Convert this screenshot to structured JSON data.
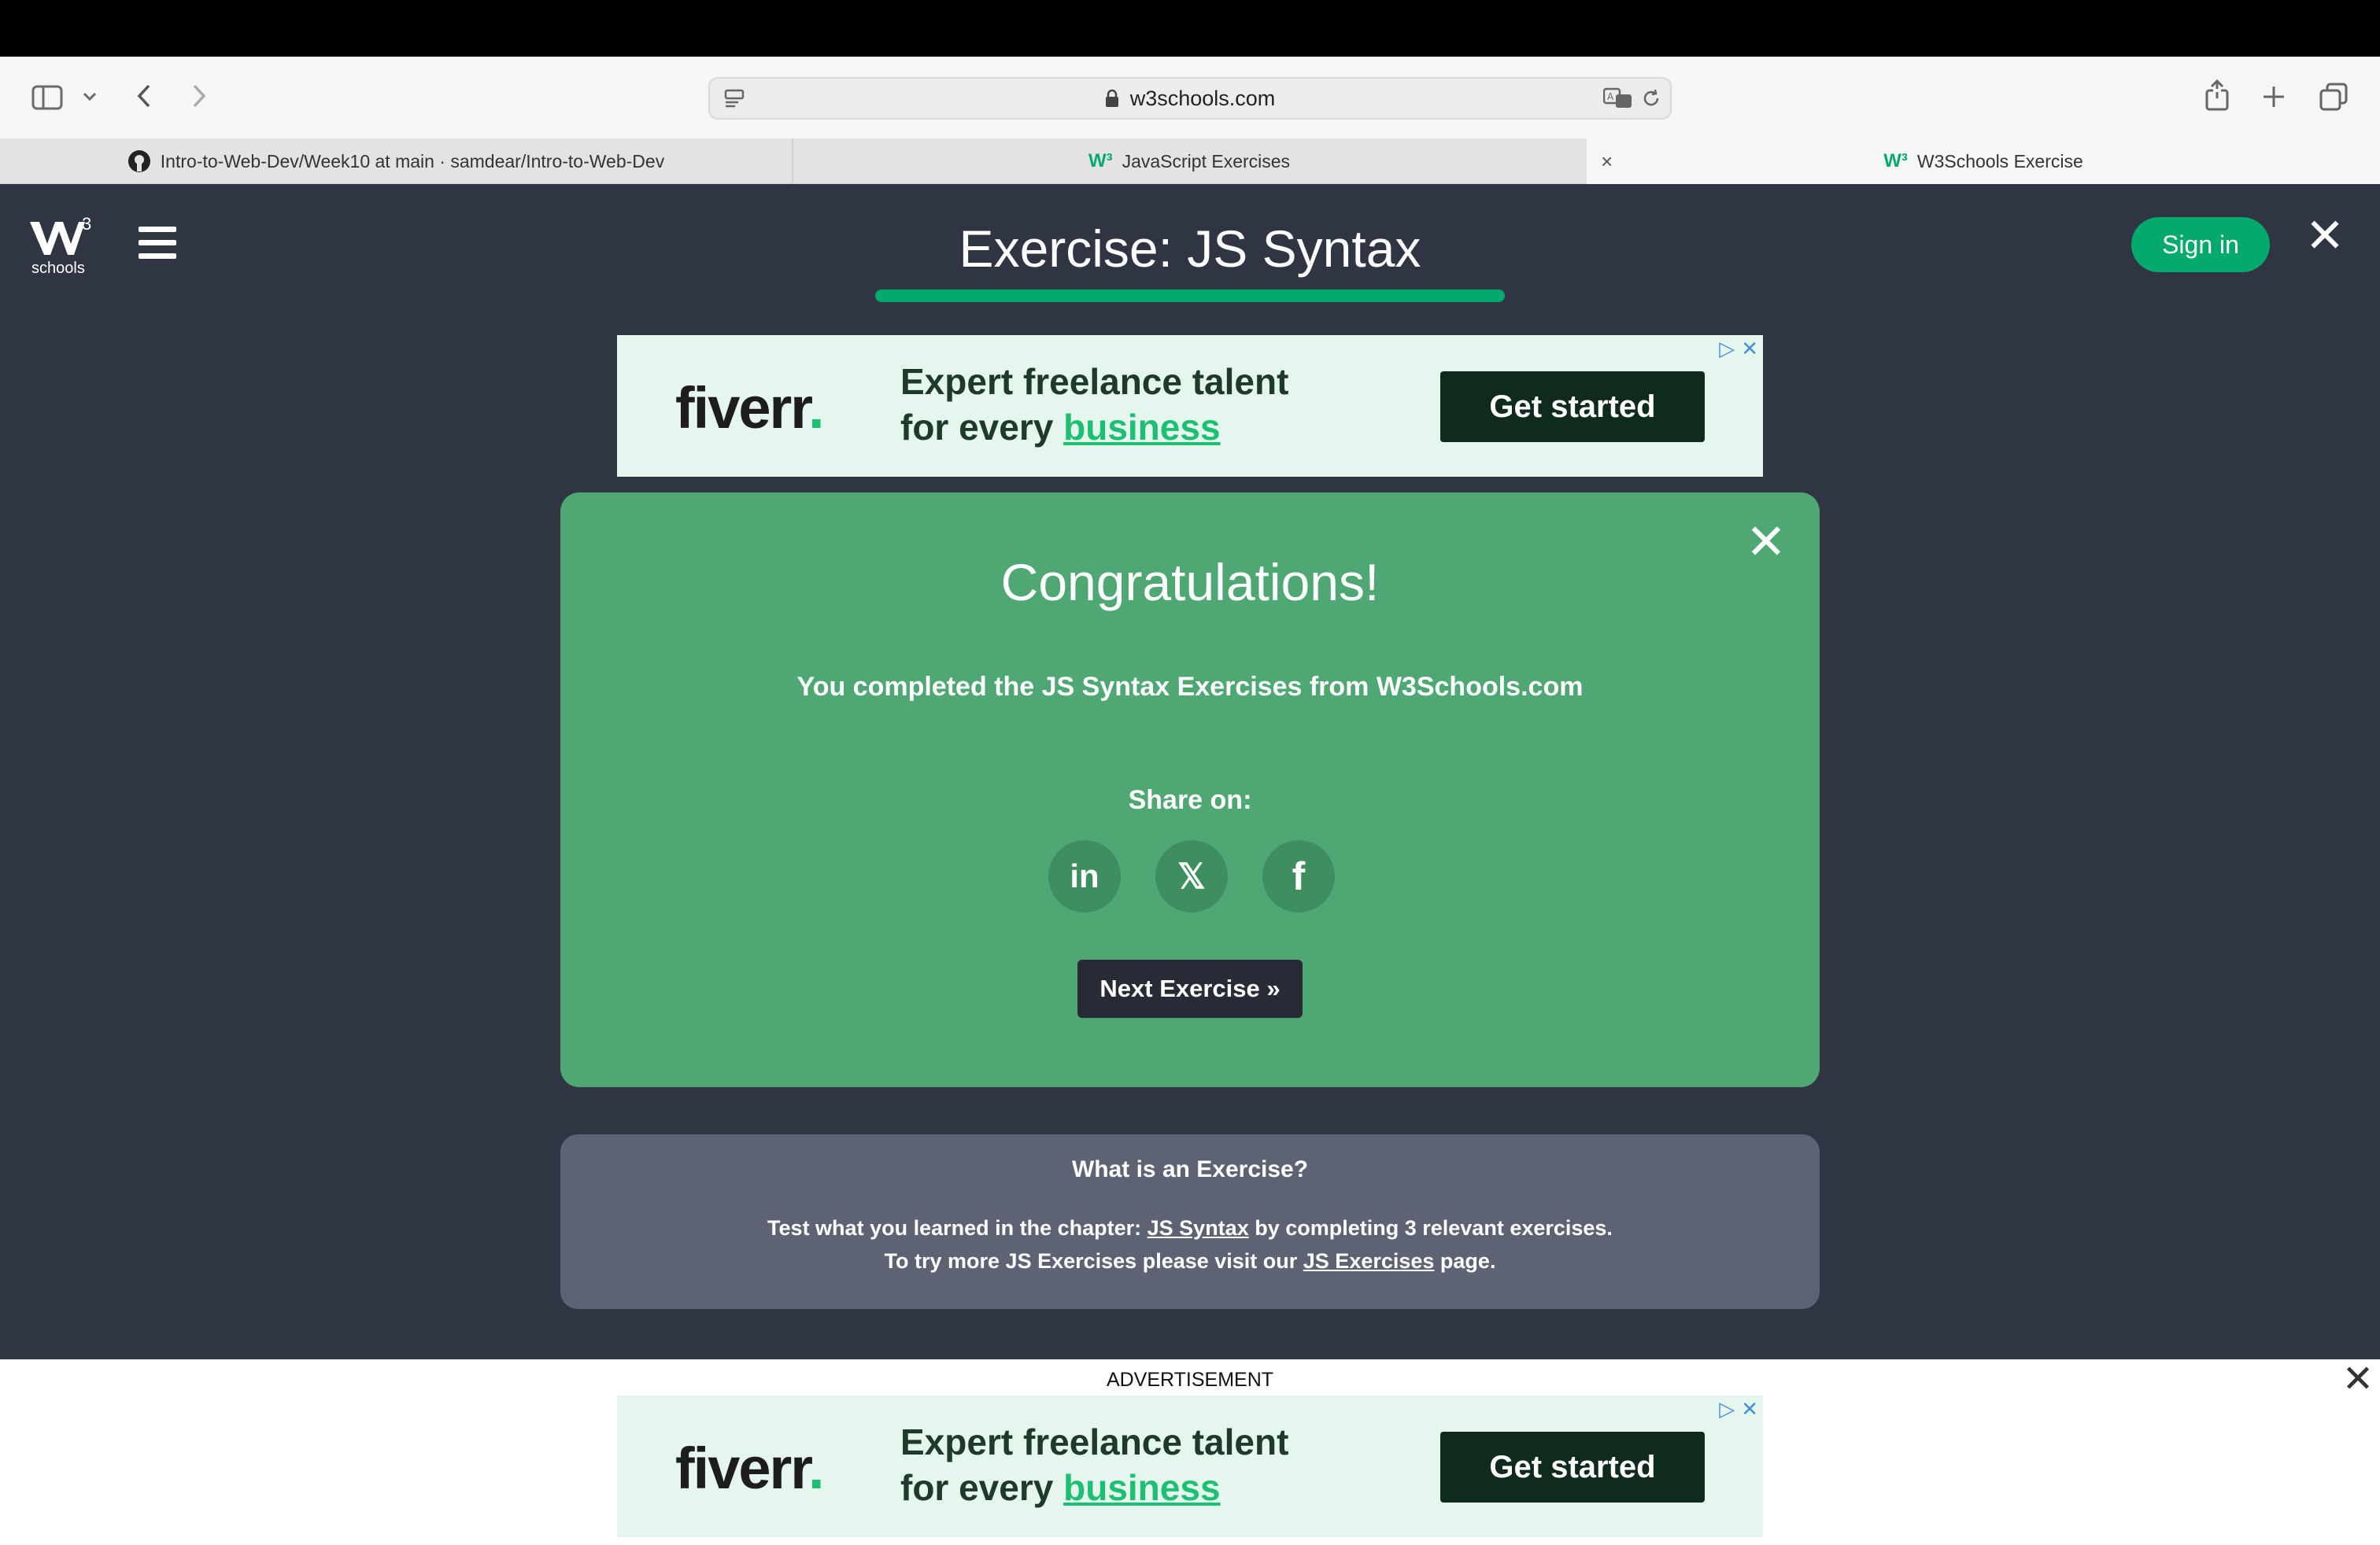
{
  "browser": {
    "url": "w3schools.com",
    "tabs": [
      {
        "label": "Intro-to-Web-Dev/Week10 at main · samdear/Intro-to-Web-Dev"
      },
      {
        "label": "JavaScript Exercises"
      },
      {
        "label": "W3Schools Exercise"
      }
    ]
  },
  "header": {
    "logo_text": "schools",
    "logo_sup": "3",
    "title": "Exercise: JS Syntax",
    "signin_label": "Sign in",
    "close_glyph": "✕"
  },
  "ad": {
    "brand": "fiverr",
    "brand_dot": ".",
    "line1": "Expert freelance talent",
    "line2_prefix": "for every ",
    "line2_link": "business",
    "cta": "Get started"
  },
  "card": {
    "title": "Congratulations!",
    "message": "You completed the JS Syntax Exercises from W3Schools.com",
    "share_label": "Share on:",
    "share_buttons": [
      {
        "label": "in",
        "icon": "linkedin-icon"
      },
      {
        "label": "𝕏",
        "icon": "x-icon"
      },
      {
        "label": "f",
        "icon": "facebook-icon"
      }
    ],
    "next_label": "Next Exercise »"
  },
  "info": {
    "heading": "What is an Exercise?",
    "line1_prefix": "Test what you learned in the chapter: ",
    "line1_link": "JS Syntax",
    "line1_suffix": " by completing 3 relevant exercises.",
    "line2_prefix": "To try more JS Exercises please visit our ",
    "line2_link": "JS Exercises",
    "line2_suffix": " page."
  },
  "bottom": {
    "advert_label": "ADVERTISEMENT"
  },
  "colors": {
    "page_bg": "#2f3542",
    "accent_green": "#04aa6d",
    "card_green": "#4fa874",
    "info_bg": "#5d6372"
  }
}
